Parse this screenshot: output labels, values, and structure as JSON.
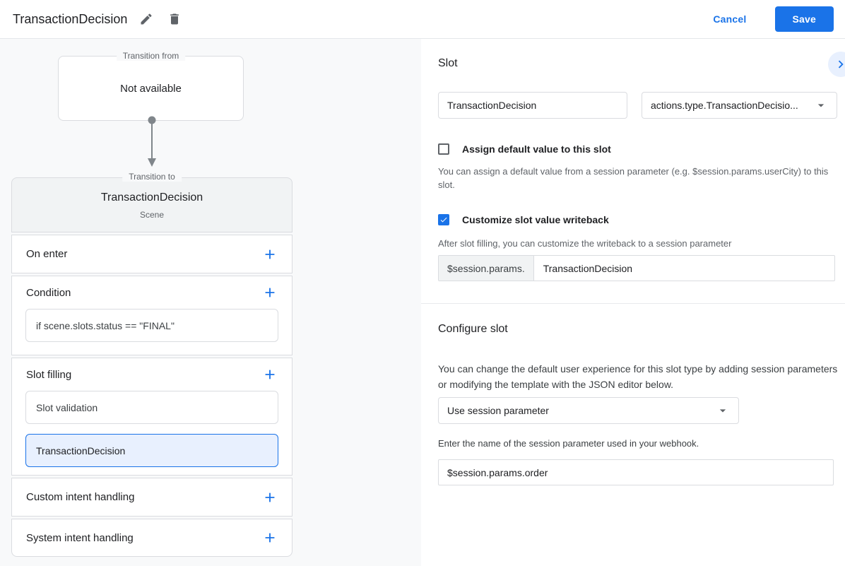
{
  "header": {
    "title": "TransactionDecision",
    "cancel_label": "Cancel",
    "save_label": "Save"
  },
  "diagram": {
    "transition_from": {
      "label": "Transition from",
      "content": "Not available"
    },
    "transition_to": {
      "label": "Transition to",
      "title": "TransactionDecision",
      "subtitle": "Scene",
      "on_enter_label": "On enter",
      "condition_label": "Condition",
      "condition_value": "if scene.slots.status == \"FINAL\"",
      "slot_filling_label": "Slot filling",
      "slot_items": [
        {
          "label": "Slot validation",
          "selected": false
        },
        {
          "label": "TransactionDecision",
          "selected": true
        }
      ],
      "custom_intent_label": "Custom intent handling",
      "system_intent_label": "System intent handling"
    }
  },
  "slot_panel": {
    "title": "Slot",
    "name_value": "TransactionDecision",
    "type_value": "actions.type.TransactionDecisio...",
    "assign_default": {
      "label": "Assign default value to this slot",
      "checked": false,
      "helper": "You can assign a default value from a session parameter (e.g. $session.params.userCity) to this slot."
    },
    "writeback": {
      "label": "Customize slot value writeback",
      "checked": true,
      "helper": "After slot filling, you can customize the writeback to a session parameter",
      "prefix": "$session.params.",
      "value": "TransactionDecision"
    }
  },
  "configure_panel": {
    "title": "Configure slot",
    "description": "You can change the default user experience for this slot type by adding session parameters or modifying the template with the JSON editor below.",
    "dropdown_value": "Use session parameter",
    "param_label": "Enter the name of the session parameter used in your webhook.",
    "param_value": "$session.params.order"
  },
  "colors": {
    "accent": "#1a73e8",
    "selected_bg": "#e8f0fe",
    "canvas_bg": "#f8f9fa"
  }
}
